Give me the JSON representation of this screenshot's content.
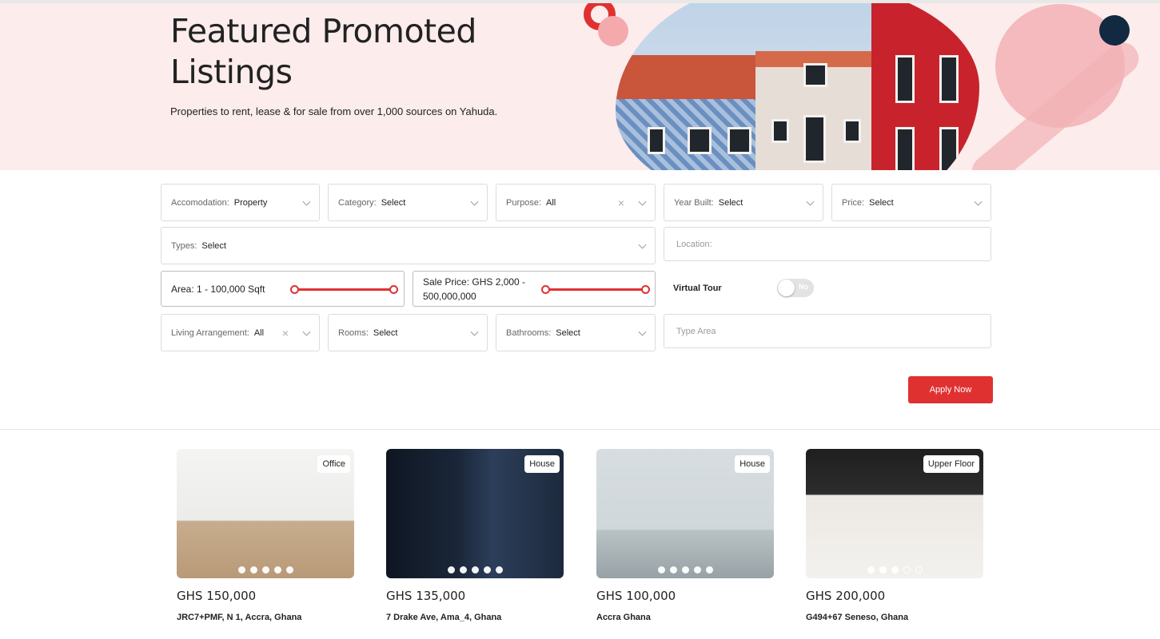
{
  "hero": {
    "title": "Featured Promoted Listings",
    "subtitle": "Properties to rent, lease & for sale from over 1,000 sources on Yahuda."
  },
  "filters": {
    "accommodation": {
      "label": "Accomodation:",
      "value": "Property"
    },
    "category": {
      "label": "Category:",
      "value": "Select"
    },
    "purpose": {
      "label": "Purpose:",
      "value": "All"
    },
    "year_built": {
      "label": "Year Built:",
      "value": "Select"
    },
    "price": {
      "label": "Price:",
      "value": "Select"
    },
    "types": {
      "label": "Types:",
      "value": "Select"
    },
    "location": {
      "placeholder": "Location:"
    },
    "area": {
      "label": "Area: 1 - 100,000 Sqft"
    },
    "sale_price": {
      "label": "Sale Price: GHS 2,000 - 500,000,000"
    },
    "virtual_tour": {
      "label": "Virtual Tour",
      "state": "No"
    },
    "living_arrangement": {
      "label": "Living Arrangement:",
      "value": "All"
    },
    "rooms": {
      "label": "Rooms:",
      "value": "Select"
    },
    "bathrooms": {
      "label": "Bathrooms:",
      "value": "Select"
    },
    "type_area": {
      "placeholder": "Type Area"
    },
    "clear_symbol": "×",
    "apply_label": "Apply Now"
  },
  "listings": [
    {
      "badge": "Office",
      "price": "GHS 150,000",
      "address": "JRC7+PMF, N 1, Accra, Ghana"
    },
    {
      "badge": "House",
      "price": "GHS 135,000",
      "address": "7 Drake Ave, Ama_4, Ghana"
    },
    {
      "badge": "House",
      "price": "GHS 100,000",
      "address": "Accra Ghana"
    },
    {
      "badge": "Upper Floor",
      "price": "GHS 200,000",
      "address": "G494+67 Seneso, Ghana"
    }
  ],
  "colors": {
    "accent": "#e03131",
    "hero_bg": "#fcecec",
    "navy": "#112a42"
  }
}
